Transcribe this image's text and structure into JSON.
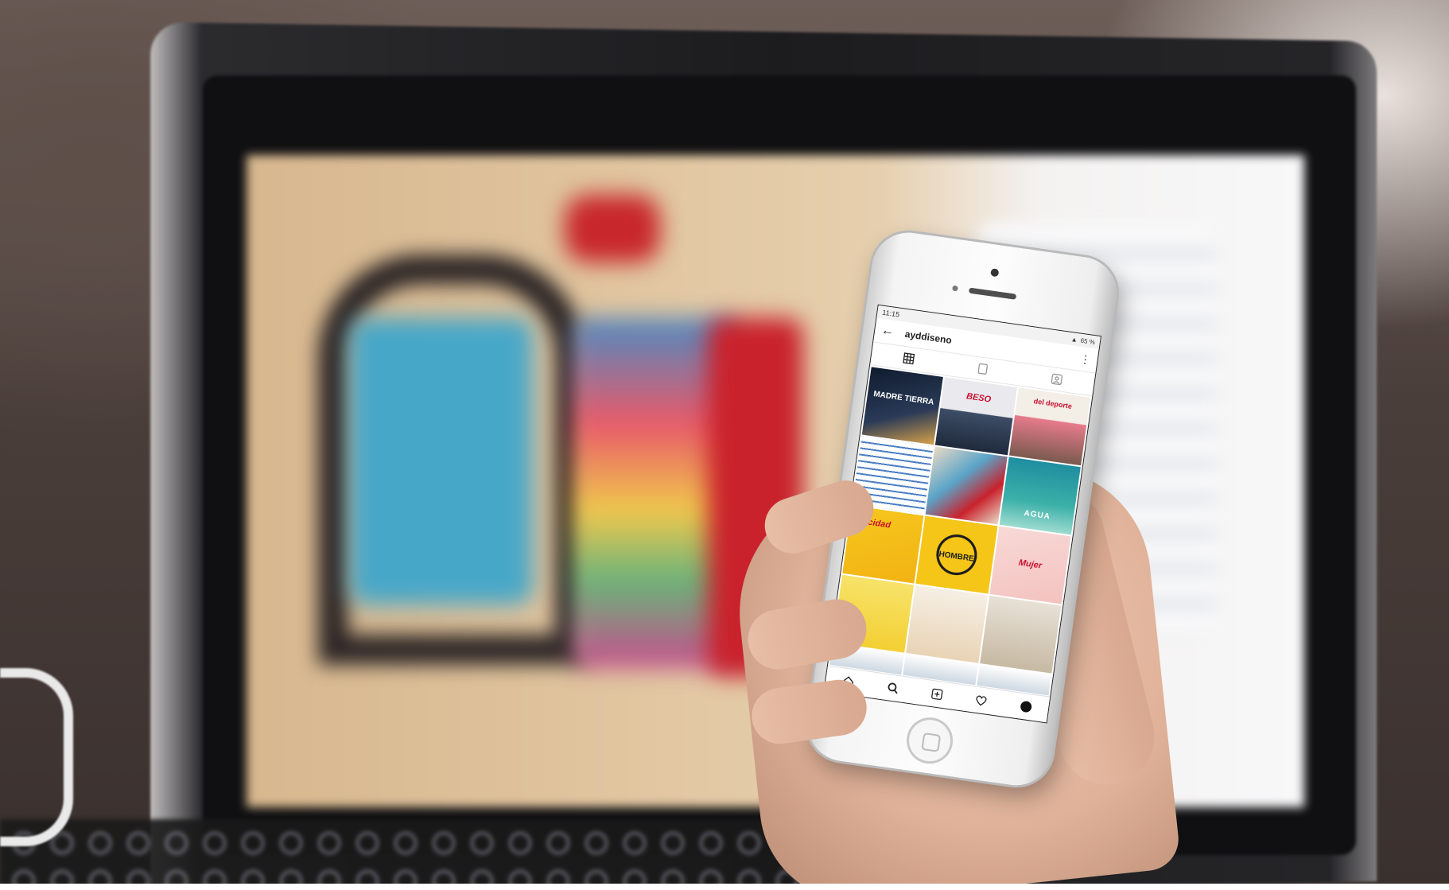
{
  "phone": {
    "statusbar": {
      "time": "11:15",
      "battery": "65 %"
    },
    "profile": {
      "username": "ayddiseno"
    },
    "tiles": [
      {
        "label": "MADRE TIERRA"
      },
      {
        "label": "BESO"
      },
      {
        "label": "del deporte"
      },
      {
        "label": ""
      },
      {
        "label": ""
      },
      {
        "label": "AGUA"
      },
      {
        "label": "Felicidad"
      },
      {
        "label": "HOMBRE"
      },
      {
        "label": "Mujer"
      },
      {
        "label": ""
      },
      {
        "label": ""
      },
      {
        "label": ""
      }
    ],
    "icons": {
      "back": "back-arrow-icon",
      "more": "more-vertical-icon",
      "grid": "grid-icon",
      "igtv": "igtv-icon",
      "tagged": "tagged-icon",
      "home": "home-icon",
      "search": "search-icon",
      "add": "add-icon",
      "heart": "heart-icon",
      "profile": "profile-icon"
    }
  },
  "colors": {
    "accent_red": "#c8102e",
    "laptop_screen": "#e2c7a2"
  }
}
